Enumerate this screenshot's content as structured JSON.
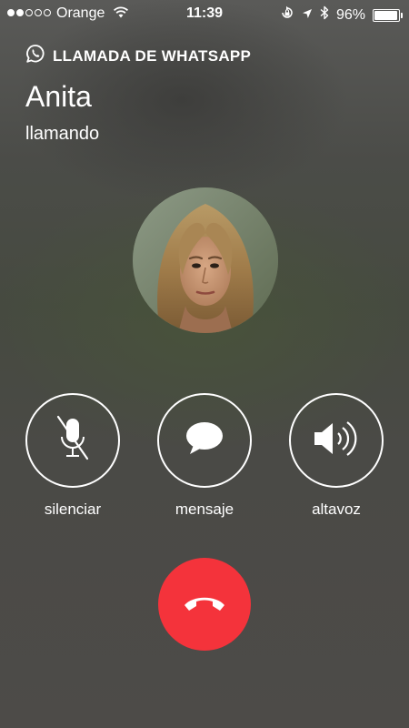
{
  "status_bar": {
    "carrier": "Orange",
    "time": "11:39",
    "battery_percent": "96%",
    "battery_level": 0.96,
    "signal_bars_filled": 2,
    "signal_bars_total": 5
  },
  "call": {
    "app_label": "LLAMADA DE WHATSAPP",
    "caller_name": "Anita",
    "status": "llamando"
  },
  "actions": {
    "mute_label": "silenciar",
    "message_label": "mensaje",
    "speaker_label": "altavoz"
  },
  "icons": {
    "app": "whatsapp-icon",
    "mute": "microphone-muted-icon",
    "message": "speech-bubble-icon",
    "speaker": "speaker-icon",
    "end_call": "phone-hangup-icon"
  },
  "colors": {
    "end_call": "#f4333b",
    "text": "#ffffff"
  }
}
